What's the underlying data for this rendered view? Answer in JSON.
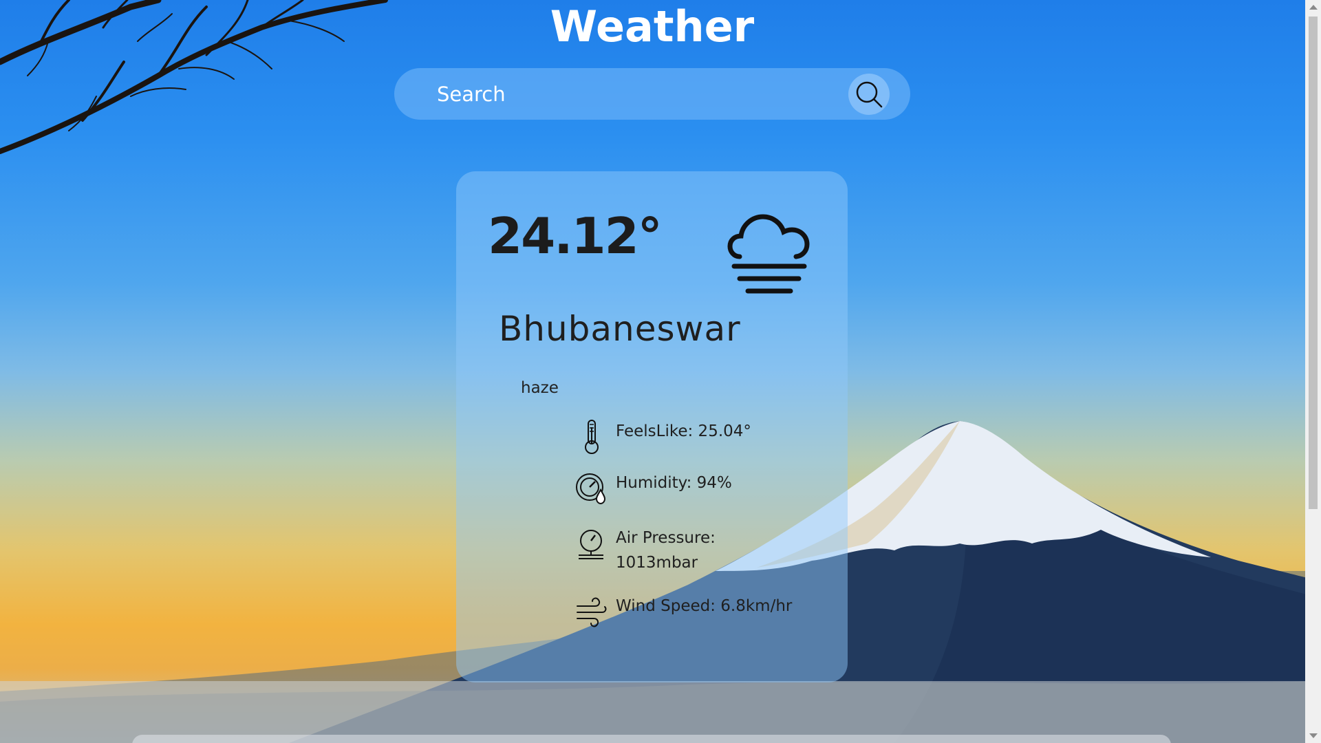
{
  "header": {
    "title": "Weather"
  },
  "search": {
    "placeholder": "Search",
    "value": ""
  },
  "weather": {
    "temperature": "24.12°",
    "city": "Bhubaneswar",
    "description": "haze",
    "condition_icon": "fog-cloud-icon",
    "details": [
      {
        "icon": "thermometer-icon",
        "text": "FeelsLike: 25.04°"
      },
      {
        "icon": "humidity-gauge-icon",
        "text": "Humidity: 94%"
      },
      {
        "icon": "barometer-icon",
        "text": "Air Pressure: 1013mbar"
      },
      {
        "icon": "wind-icon",
        "text": "Wind Speed: 6.8km/hr"
      }
    ]
  },
  "colors": {
    "text_dark": "#1c1c1c",
    "title": "#ffffff",
    "sky_top": "#1f7ee9",
    "horizon": "#f2b340"
  }
}
